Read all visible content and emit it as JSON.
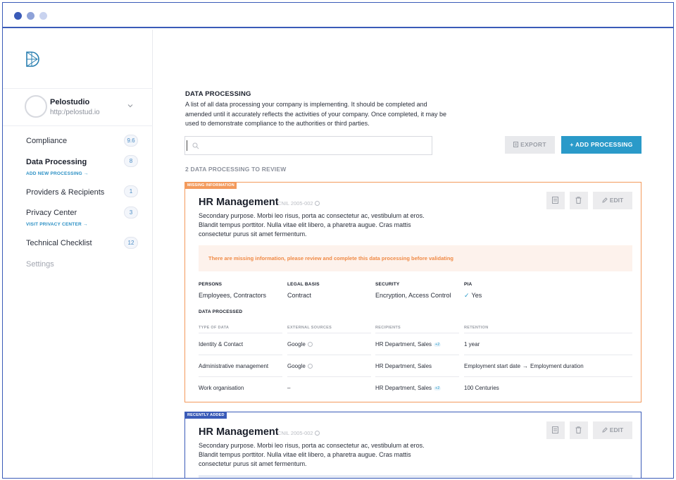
{
  "org": {
    "name": "Pelostudio",
    "url": "http:/pelostud.io"
  },
  "nav": {
    "items": [
      {
        "label": "Compliance",
        "badge": "9.6"
      },
      {
        "label": "Data Processing",
        "badge": "8",
        "sub": "ADD NEW PROCESSING →"
      },
      {
        "label": "Providers & Recipients",
        "badge": "1"
      },
      {
        "label": "Privacy Center",
        "badge": "3",
        "sub": "VISIT PRIVACY CENTER →"
      },
      {
        "label": "Technical Checklist",
        "badge": "12"
      },
      {
        "label": "Settings"
      }
    ]
  },
  "page": {
    "title": "DATA PROCESSING",
    "description": "A list of all data processing your company is implementing. It should be completed and amended until it accurately reflects the activities of your company. Once completed, it may be used to demonstrate compliance to the authorities or third parties.",
    "search_placeholder": "",
    "export_label": "EXPORT",
    "add_label": "+ ADD PROCESSING",
    "review_title": "2 DATA PROCESSING TO REVIEW"
  },
  "cards": [
    {
      "tag": "MISSING INFORMATION",
      "title": "HR Management",
      "ref": "CNIL 2005-002",
      "description": "Secondary purpose. Morbi leo risus, porta ac consectetur ac, vestibulum at eros. Blandit tempus porttitor. Nulla vitae elit libero, a pharetra augue. Cras mattis consectetur purus sit amet fermentum.",
      "edit_label": "EDIT",
      "alert": "There are missing information, please review and complete this data processing before validating",
      "fields": {
        "persons_label": "PERSONS",
        "persons": "Employees, Contractors",
        "legal_label": "LEGAL BASIS",
        "legal": "Contract",
        "security_label": "SECURITY",
        "security": "Encryption, Access Control",
        "pia_label": "PIA",
        "pia": "Yes"
      },
      "data_processed_label": "DATA PROCESSED",
      "table": {
        "headers": [
          "TYPE OF DATA",
          "EXTERNAL SOURCES",
          "RECIPIENTS",
          "RETENTION"
        ],
        "rows": [
          {
            "type": "Identity & Contact",
            "source": "Google",
            "recipients": "HR Department, Sales",
            "extra": "+2",
            "retention": "1 year",
            "retention_to": ""
          },
          {
            "type": "Administrative management",
            "source": "Google",
            "recipients": "HR Department, Sales",
            "extra": "",
            "retention": "Employment start date",
            "retention_to": "Employment duration"
          },
          {
            "type": "Work organisation",
            "source": "–",
            "recipients": "HR Department, Sales",
            "extra": "+2",
            "retention": "100 Centuries",
            "retention_to": ""
          }
        ]
      }
    },
    {
      "tag": "RECENTLY ADDED",
      "title": "HR Management",
      "ref": "CNIL 2005-002",
      "description": "Secondary purpose. Morbi leo risus, porta ac consectetur ac, vestibulum at eros. Blandit tempus porttitor. Nulla vitae elit libero, a pharetra augue. Cras mattis consectetur purus sit amet fermentum.",
      "edit_label": "EDIT"
    }
  ]
}
